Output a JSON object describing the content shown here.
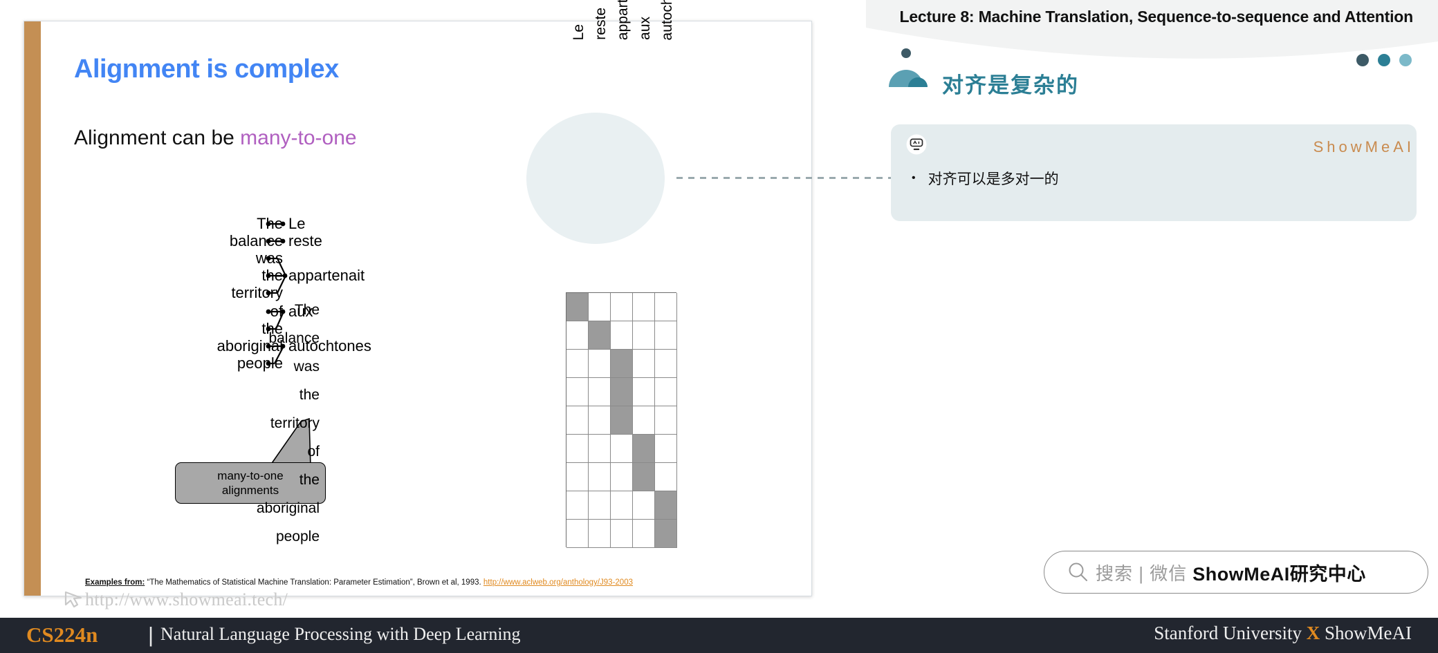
{
  "header": {
    "lecture_title": "Lecture 8: Machine Translation, Sequence-to-sequence and Attention",
    "chinese_title": "对齐是复杂的",
    "dot_colors": [
      "#3d5a66",
      "#2c7f95",
      "#7cb9c9"
    ]
  },
  "note_box": {
    "brand": "ShowMeAI",
    "bullet_char": "•",
    "items": [
      "对齐可以是多对一的"
    ],
    "bot_icon_name": "ai-robot-icon",
    "bg_color": "#e4ecee"
  },
  "slide": {
    "title": "Alignment is complex",
    "title_color": "#4285f4",
    "subtitle_plain": "Alignment can be ",
    "subtitle_highlight": "many-to-one",
    "highlight_color": "#b05fc0",
    "sidebar_color": "#c48f54",
    "callout_line1": "many-to-one",
    "callout_line2": "alignments",
    "watermark_url": "http://www.showmeai.tech/",
    "citation": {
      "prefix": "Examples from:",
      "text": "“The Mathematics of Statistical Machine Translation: Parameter Estimation”, Brown et al, 1993.",
      "link": "http://www.aclweb.org/anthology/J93-2003",
      "link_color": "#e08a20"
    }
  },
  "alignment_diagram": {
    "source_words": [
      "The",
      "balance",
      "was",
      "the",
      "territory",
      "of",
      "the",
      "aboriginal",
      "people"
    ],
    "target_words": [
      "Le",
      "reste",
      "appartenait",
      "aux",
      "autochtones"
    ],
    "links": [
      {
        "source": "The",
        "target": "Le"
      },
      {
        "source": "balance",
        "target": "reste"
      },
      {
        "source": "was",
        "target": "appartenait"
      },
      {
        "source": "the",
        "target": "appartenait"
      },
      {
        "source": "territory",
        "target": "appartenait"
      },
      {
        "source": "of",
        "target": "aux"
      },
      {
        "source": "the",
        "target": "aux"
      },
      {
        "source": "aboriginal",
        "target": "autochtones"
      },
      {
        "source": "people",
        "target": "autochtones"
      }
    ]
  },
  "chart_data": {
    "type": "heatmap",
    "title": "",
    "xlabel": "",
    "ylabel": "",
    "columns": [
      "Le",
      "reste",
      "appartenait",
      "aux",
      "autochtones"
    ],
    "rows": [
      "The",
      "balance",
      "was",
      "the",
      "territory",
      "of",
      "the",
      "aboriginal",
      "people"
    ],
    "values": [
      [
        1,
        0,
        0,
        0,
        0
      ],
      [
        0,
        1,
        0,
        0,
        0
      ],
      [
        0,
        0,
        1,
        0,
        0
      ],
      [
        0,
        0,
        1,
        0,
        0
      ],
      [
        0,
        0,
        1,
        0,
        0
      ],
      [
        0,
        0,
        0,
        1,
        0
      ],
      [
        0,
        0,
        0,
        1,
        0
      ],
      [
        0,
        0,
        0,
        0,
        1
      ],
      [
        0,
        0,
        0,
        0,
        1
      ]
    ],
    "on_color": "#9b9b9b",
    "off_color": "#ffffff",
    "grid": true,
    "legend": "none"
  },
  "search": {
    "placeholder": "搜索 | 微信",
    "brand": "ShowMeAI研究中心",
    "icon_name": "search-icon"
  },
  "footer": {
    "course_code": "CS224n",
    "divider": "|",
    "course_name": "Natural Language Processing with Deep Learning",
    "right_prefix": "Stanford University ",
    "right_x": "X",
    "right_suffix": " ShowMeAI",
    "accent_color": "#e08a20",
    "bg_color": "#22262f"
  }
}
